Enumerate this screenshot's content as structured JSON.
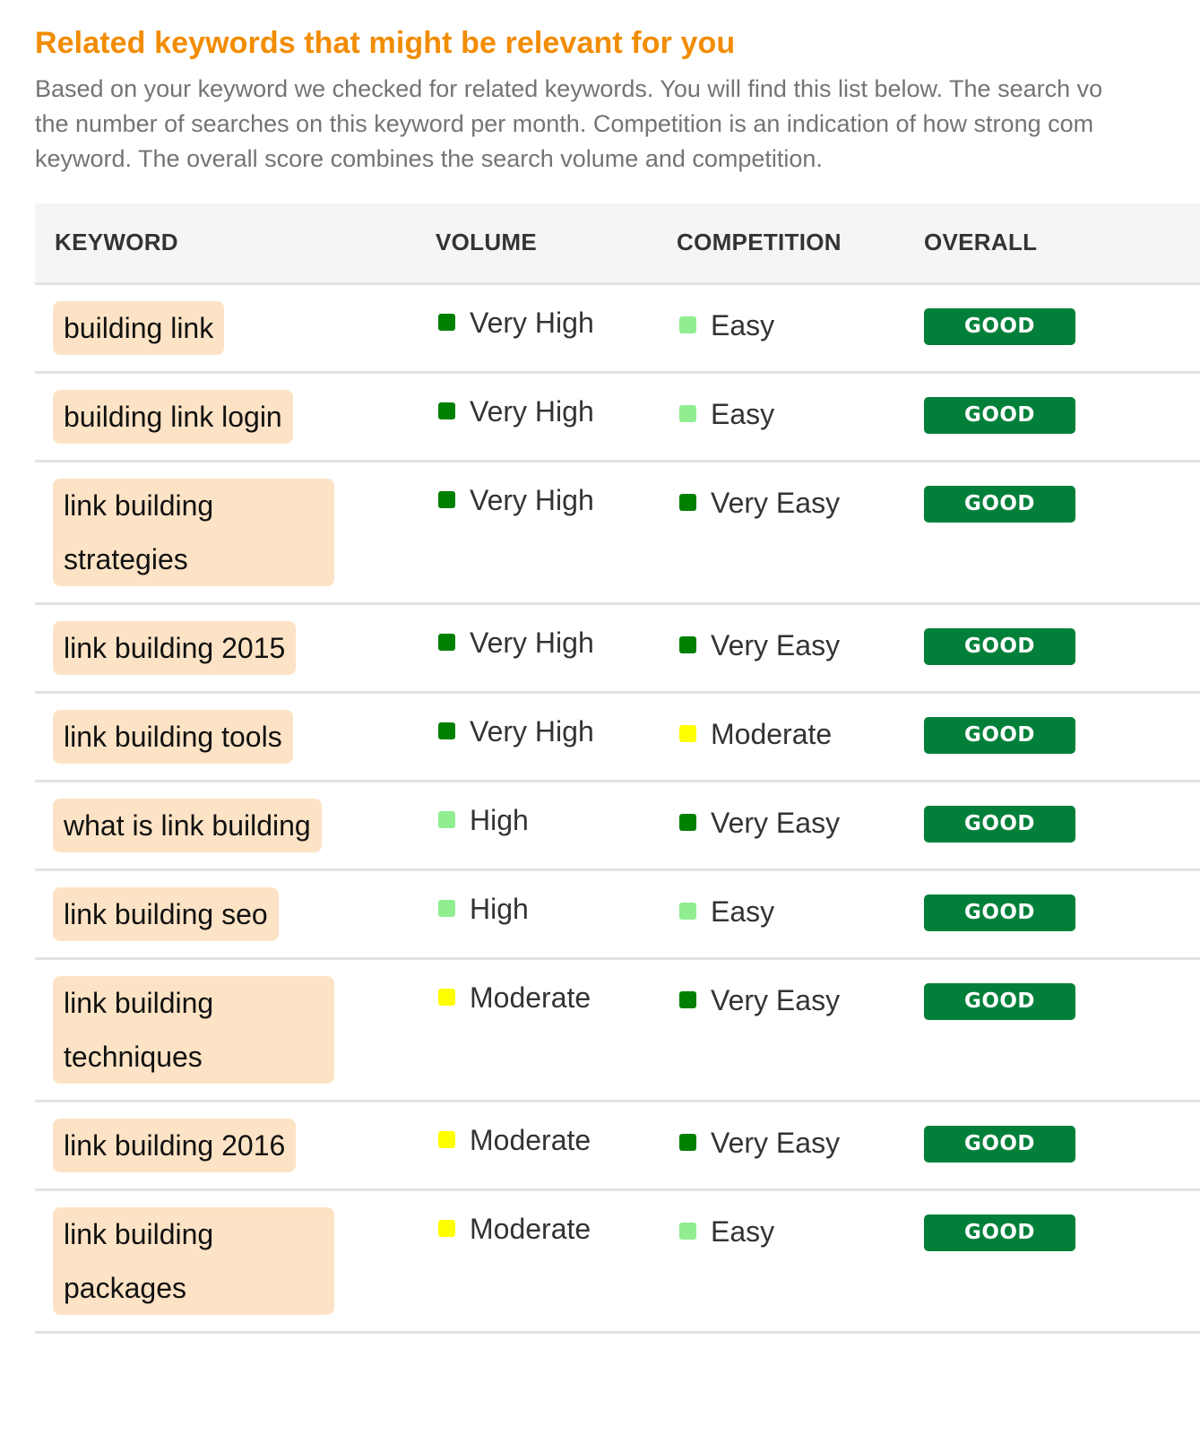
{
  "section": {
    "title": "Related keywords that might be relevant for you",
    "description_lines": [
      "Based on your keyword we checked for related keywords. You will find this list below. The search vo",
      "the number of searches on this keyword per month. Competition is an indication of how strong com",
      "keyword. The overall score combines the search volume and competition."
    ]
  },
  "colors": {
    "title": "#f28c00",
    "keyword_pill": "#fde3c5",
    "good_badge": "#02803a",
    "level": {
      "Very High": "#008000",
      "High": "#90ee90",
      "Moderate": "#ffff00",
      "Easy": "#90ee90",
      "Very Easy": "#008000"
    }
  },
  "table": {
    "headers": [
      "KEYWORD",
      "VOLUME",
      "COMPETITION",
      "OVERALL"
    ],
    "rows": [
      {
        "keyword": "building link",
        "volume": "Very High",
        "competition": "Easy",
        "overall": "GOOD"
      },
      {
        "keyword": "building link login",
        "volume": "Very High",
        "competition": "Easy",
        "overall": "GOOD"
      },
      {
        "keyword": "link building strategies",
        "volume": "Very High",
        "competition": "Very Easy",
        "overall": "GOOD"
      },
      {
        "keyword": "link building 2015",
        "volume": "Very High",
        "competition": "Very Easy",
        "overall": "GOOD"
      },
      {
        "keyword": "link building tools",
        "volume": "Very High",
        "competition": "Moderate",
        "overall": "GOOD"
      },
      {
        "keyword": "what is link building",
        "volume": "High",
        "competition": "Very Easy",
        "overall": "GOOD"
      },
      {
        "keyword": "link building seo",
        "volume": "High",
        "competition": "Easy",
        "overall": "GOOD"
      },
      {
        "keyword": "link building techniques",
        "volume": "Moderate",
        "competition": "Very Easy",
        "overall": "GOOD"
      },
      {
        "keyword": "link building 2016",
        "volume": "Moderate",
        "competition": "Very Easy",
        "overall": "GOOD"
      },
      {
        "keyword": "link building packages",
        "volume": "Moderate",
        "competition": "Easy",
        "overall": "GOOD"
      }
    ]
  }
}
